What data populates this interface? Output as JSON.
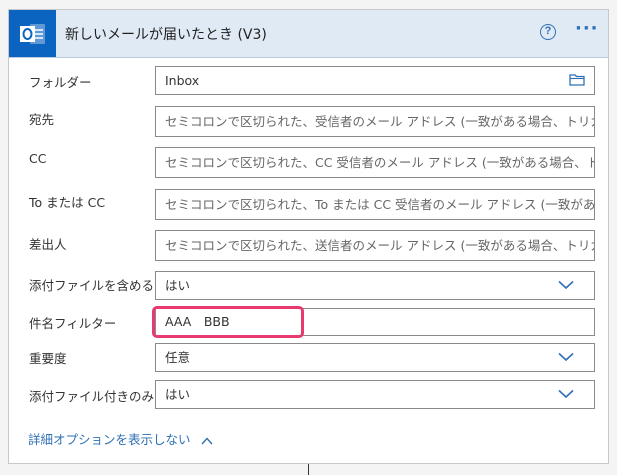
{
  "header": {
    "title": "新しいメールが届いたとき (V3)",
    "help_icon": "question-circle-icon",
    "more_icon": "ellipsis-icon",
    "app_icon": "outlook-icon",
    "help_glyph": "?",
    "more_glyph": "···"
  },
  "fields": [
    {
      "label": "フォルダー",
      "value": "Inbox",
      "type": "folder-picker"
    },
    {
      "label": "宛先",
      "placeholder": "セミコロンで区切られた、受信者のメール アドレス (一致がある場合、トリガーが発",
      "type": "text"
    },
    {
      "label": "CC",
      "placeholder": "セミコロンで区切られた、CC 受信者のメール アドレス (一致がある場合、トリガー",
      "type": "text"
    },
    {
      "label": "To または CC",
      "placeholder": "セミコロンで区切られた、To または CC 受信者のメール アドレス (一致がある場合",
      "type": "text"
    },
    {
      "label": "差出人",
      "placeholder": "セミコロンで区切られた、送信者のメール アドレス (一致がある場合、トリガーが発",
      "type": "text"
    },
    {
      "label": "添付ファイルを含める",
      "value": "はい",
      "type": "dropdown"
    },
    {
      "label": "件名フィルター",
      "value": "AAA　BBB",
      "type": "text"
    },
    {
      "label": "重要度",
      "value": "任意",
      "type": "dropdown"
    },
    {
      "label": "添付ファイル付きのみ",
      "value": "はい",
      "type": "dropdown"
    }
  ],
  "advanced_options_label": "詳細オプションを表示しない",
  "colors": {
    "header_bg": "#dfeaf5",
    "app_tile": "#0b64c0",
    "accent": "#2f6fb5",
    "highlight": "#e83a6f"
  }
}
